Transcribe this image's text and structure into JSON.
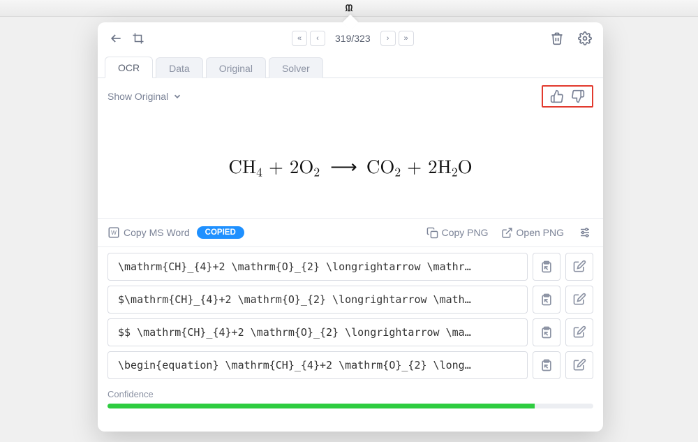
{
  "menubar": {
    "app_glyph": "ᙢ"
  },
  "toolbar": {
    "page_current": 319,
    "page_total": 323,
    "page_display": "319/323"
  },
  "tabs": [
    {
      "id": "ocr",
      "label": "OCR",
      "active": true
    },
    {
      "id": "data",
      "label": "Data",
      "active": false
    },
    {
      "id": "original",
      "label": "Original",
      "active": false
    },
    {
      "id": "solver",
      "label": "Solver",
      "active": false
    }
  ],
  "subbar": {
    "show_original_label": "Show Original"
  },
  "equation": {
    "display_html": "CH<sub>4</sub> + 2O<sub>2</sub> <span class='arrow'>⟶</span> CO<sub>2</sub> + 2H<sub>2</sub>O"
  },
  "actionbar": {
    "copy_word_label": "Copy MS Word",
    "copied_badge": "COPIED",
    "copy_png_label": "Copy PNG",
    "open_png_label": "Open PNG"
  },
  "results": [
    {
      "code": "\\mathrm{CH}_{4}+2 \\mathrm{O}_{2} \\longrightarrow \\mathr…"
    },
    {
      "code": "$\\mathrm{CH}_{4}+2 \\mathrm{O}_{2} \\longrightarrow \\math…"
    },
    {
      "code": "$$ \\mathrm{CH}_{4}+2 \\mathrm{O}_{2} \\longrightarrow \\ma…"
    },
    {
      "code": "\\begin{equation} \\mathrm{CH}_{4}+2 \\mathrm{O}_{2} \\long…"
    }
  ],
  "confidence": {
    "label": "Confidence",
    "percent": 88
  }
}
